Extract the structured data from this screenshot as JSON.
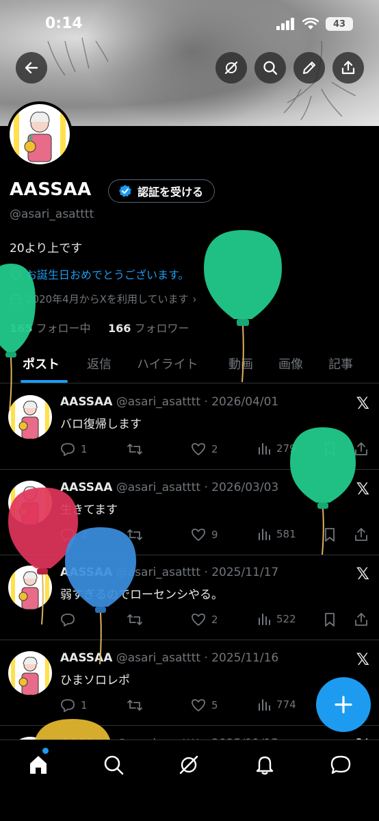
{
  "status_bar": {
    "time": "0:14",
    "battery": "43"
  },
  "profile": {
    "name": "AASSAA",
    "verify_button": "認証を受ける",
    "handle": "@asari_asatttt",
    "bio": "20より上です",
    "birthday_text": "お誕生日おめでとうございます。",
    "joined": "2020年4月からXを利用しています",
    "following_count": "165",
    "following_label": "フォロー中",
    "followers_count": "166",
    "followers_label": "フォロワー"
  },
  "tabs": [
    "ポスト",
    "返信",
    "ハイライト",
    "動画",
    "画像",
    "記事"
  ],
  "tweets": [
    {
      "name": "AASSAA",
      "meta": "@asari_asatttt · 2026/04/01",
      "text": "バロ復帰します",
      "replies": "1",
      "retweets": "",
      "likes": "2",
      "views": "279"
    },
    {
      "name": "AASSAA",
      "meta": "@asari_asatttt · 2026/03/03",
      "text": "生きてます",
      "replies": "2",
      "retweets": "",
      "likes": "9",
      "views": "581"
    },
    {
      "name": "AASSAA",
      "meta": "@asari_asatttt · 2025/11/17",
      "text": "弱すぎるのでローセンシやる。",
      "replies": "",
      "retweets": "",
      "likes": "2",
      "views": "522"
    },
    {
      "name": "AASSAA",
      "meta": "@asari_asatttt · 2025/11/16",
      "text": "ひまソロレポ",
      "replies": "1",
      "retweets": "",
      "likes": "5",
      "views": "774"
    },
    {
      "name": "AASSAA",
      "meta": "@asari_asatttt · 2025/11/15",
      "text": "",
      "replies": "",
      "retweets": "",
      "likes": "",
      "views": ""
    }
  ],
  "colors": {
    "accent": "#1d9bf0",
    "background": "#000000",
    "muted": "#71767b"
  },
  "icons": {
    "back": "arrow-left-icon",
    "grok": "grok-icon",
    "search": "search-icon",
    "edit": "pencil-icon",
    "share": "share-icon"
  }
}
